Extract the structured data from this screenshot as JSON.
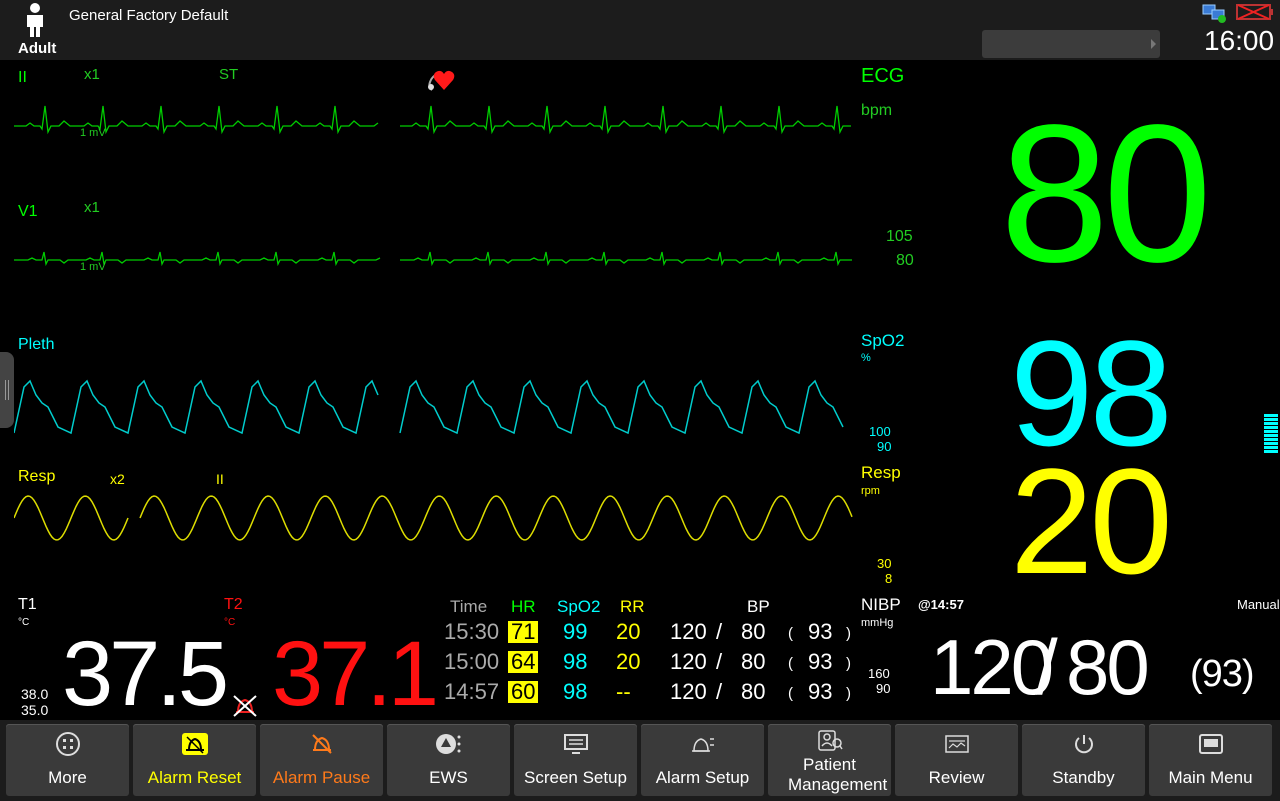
{
  "header": {
    "patient_type": "Adult",
    "config_name": "General Factory Default",
    "clock": "16:00"
  },
  "ecg": {
    "lead1": "II",
    "gain1": "x1",
    "st_label": "ST",
    "lead2": "V1",
    "gain2": "x1",
    "mv1": "1 mV",
    "mv2": "1 mV",
    "param_label": "ECG",
    "unit": "bpm",
    "limit_high": "105",
    "limit_low": "80",
    "value": "80"
  },
  "spo2": {
    "wave_label": "Pleth",
    "param_label": "SpO2",
    "unit": "%",
    "limit_high": "100",
    "limit_low": "90",
    "value": "98"
  },
  "resp": {
    "wave_label": "Resp",
    "gain": "x2",
    "lead": "II",
    "param_label": "Resp",
    "unit": "rpm",
    "limit_high": "30",
    "limit_low": "8",
    "value": "20"
  },
  "temp": {
    "t1_label": "T1",
    "t1_unit": "°C",
    "t1_limit_high": "38.0",
    "t1_limit_low": "35.0",
    "t1_value": "37.5",
    "t2_label": "T2",
    "t2_unit": "°C",
    "t2_value": "37.1"
  },
  "trend_table": {
    "headers": [
      "Time",
      "HR",
      "SpO2",
      "RR",
      "BP"
    ],
    "rows": [
      {
        "time": "15:30",
        "hr": "71",
        "spo2": "99",
        "rr": "20",
        "sys": "120",
        "sep": "/",
        "dia": "80",
        "map_open": "(",
        "map": "93",
        "map_close": ")"
      },
      {
        "time": "15:00",
        "hr": "64",
        "spo2": "98",
        "rr": "20",
        "sys": "120",
        "sep": "/",
        "dia": "80",
        "map_open": "(",
        "map": "93",
        "map_close": ")"
      },
      {
        "time": "14:57",
        "hr": "60",
        "spo2": "98",
        "rr": "--",
        "sys": "120",
        "sep": "/",
        "dia": "80",
        "map_open": "(",
        "map": "93",
        "map_close": ")"
      }
    ]
  },
  "nibp": {
    "label": "NIBP",
    "unit": "mmHg",
    "time": "@14:57",
    "mode": "Manual",
    "limit_high": "160",
    "limit_low": "90",
    "systolic": "120",
    "separator": "/",
    "diastolic": "80",
    "mean": "(93)"
  },
  "buttons": [
    {
      "label": "More",
      "icon": "more-icon"
    },
    {
      "label": "Alarm Reset",
      "icon": "alarm-reset-icon"
    },
    {
      "label": "Alarm Pause",
      "icon": "alarm-pause-icon"
    },
    {
      "label": "EWS",
      "icon": "ews-icon"
    },
    {
      "label": "Screen Setup",
      "icon": "screen-setup-icon"
    },
    {
      "label": "Alarm Setup",
      "icon": "alarm-setup-icon"
    },
    {
      "label": "Patient Management",
      "icon": "patient-management-icon"
    },
    {
      "label": "Review",
      "icon": "review-icon"
    },
    {
      "label": "Standby",
      "icon": "standby-icon"
    },
    {
      "label": "Main Menu",
      "icon": "main-menu-icon"
    }
  ],
  "colors": {
    "ecg": "#00ff00",
    "spo2": "#00ffff",
    "resp": "#ffff00",
    "t2": "#ff1111",
    "alarm_pause": "#ff7a1a"
  }
}
